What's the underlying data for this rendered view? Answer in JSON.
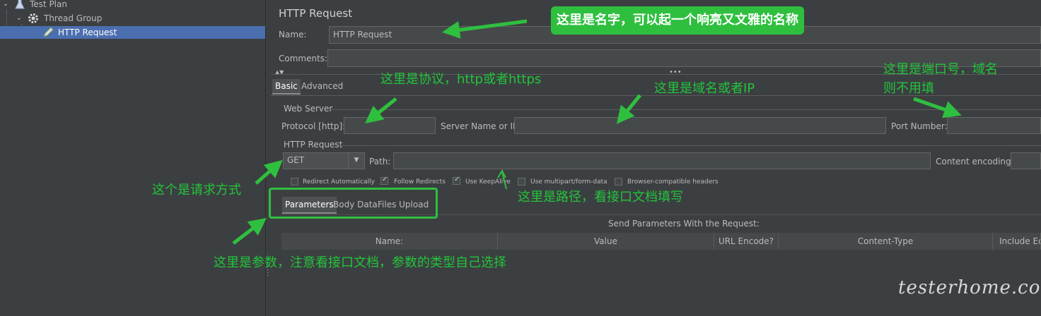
{
  "tree": {
    "test_plan": "Test Plan",
    "thread_group": "Thread Group",
    "http_request": "HTTP Request"
  },
  "panel": {
    "title": "HTTP Request",
    "name_label": "Name:",
    "name_value": "HTTP Request",
    "comments_label": "Comments:",
    "comments_value": ""
  },
  "tabs": {
    "basic": "Basic",
    "advanced": "Advanced"
  },
  "web_server": {
    "group_label": "Web Server",
    "protocol_label": "Protocol [http]:",
    "protocol_value": "",
    "server_label": "Server Name or IP:",
    "server_value": "",
    "port_label": "Port Number:",
    "port_value": ""
  },
  "http_request": {
    "group_label": "HTTP Request",
    "method": "GET",
    "path_label": "Path:",
    "path_value": "",
    "encoding_label": "Content encoding:",
    "encoding_value": ""
  },
  "checkboxes": [
    {
      "label": "Redirect Automatically",
      "checked": false
    },
    {
      "label": "Follow Redirects",
      "checked": true
    },
    {
      "label": "Use KeepAlive",
      "checked": true
    },
    {
      "label": "Use multipart/form-data",
      "checked": false
    },
    {
      "label": "Browser-compatible headers",
      "checked": false
    }
  ],
  "param_tabs": {
    "parameters": "Parameters",
    "body_data": "Body Data",
    "files_upload": "Files Upload"
  },
  "params_table": {
    "caption": "Send Parameters With the Request:",
    "columns": [
      "Name:",
      "Value",
      "URL Encode?",
      "Content-Type",
      "Include Equ"
    ]
  },
  "annotations": {
    "name_note": "这里是名字，可以起一个响亮又文雅的名称",
    "protocol_note": "这里是协议，http或者https",
    "domain_note": "这里是域名或者IP",
    "port_note_line1": "这里是端口号，域名",
    "port_note_line2": "则不用填",
    "method_note": "这个是请求方式",
    "path_note": "这里是路径，看接口文档填写",
    "params_note": "这里是参数，注意看接口文档，参数的类型自己选择"
  },
  "watermark": "testerhome.com",
  "colors": {
    "background": "#3c3f41",
    "selection": "#4b6eaf",
    "annotation_green": "#2fbf3f"
  }
}
